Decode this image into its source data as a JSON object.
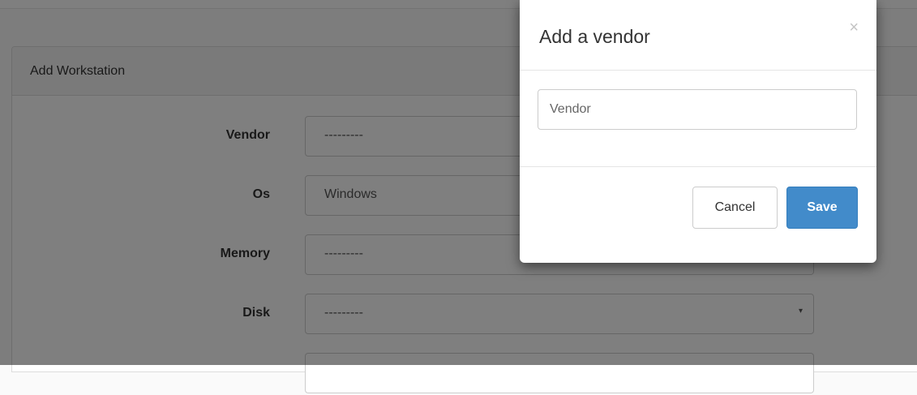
{
  "panel": {
    "heading": "Add Workstation"
  },
  "form": {
    "rows": [
      {
        "label": "Vendor",
        "value": "---------"
      },
      {
        "label": "Os",
        "value": "Windows"
      },
      {
        "label": "Memory",
        "value": "---------"
      },
      {
        "label": "Disk",
        "value": "---------"
      }
    ]
  },
  "modal": {
    "title": "Add a vendor",
    "close_symbol": "×",
    "vendor_placeholder": "Vendor",
    "cancel_label": "Cancel",
    "save_label": "Save"
  },
  "icons": {
    "dropdown_caret": "▾",
    "close": "close-icon"
  },
  "colors": {
    "primary": "#428bca",
    "backdrop": "rgba(0,0,0,0.5)"
  }
}
